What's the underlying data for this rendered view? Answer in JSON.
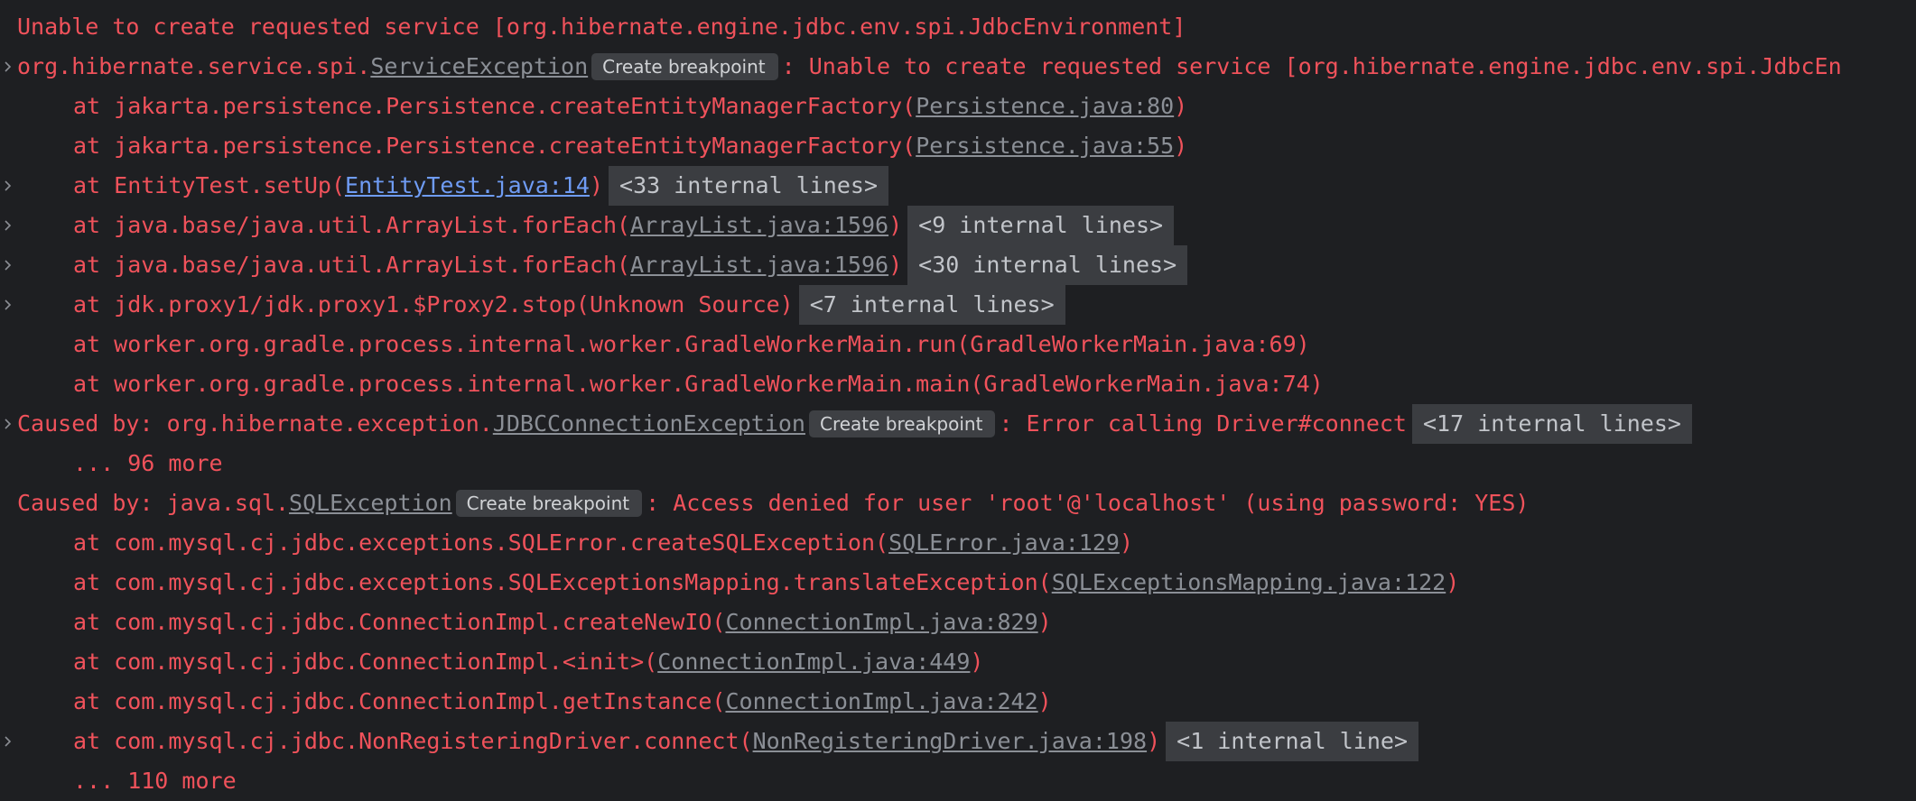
{
  "console": {
    "header": "Unable to create requested service [org.hibernate.engine.jdbc.env.spi.JdbcEnvironment]",
    "breakpoint_label": "Create breakpoint",
    "service_exception": {
      "prefix": "org.hibernate.service.spi.",
      "class_link": "ServiceException",
      "message": ": Unable to create requested service [org.hibernate.engine.jdbc.env.spi.JdbcEn"
    },
    "frames1": [
      {
        "text": "at jakarta.persistence.Persistence.createEntityManagerFactory(",
        "link": "Persistence.java:80",
        "suffix": ")"
      },
      {
        "text": "at jakarta.persistence.Persistence.createEntityManagerFactory(",
        "link": "Persistence.java:55",
        "suffix": ")"
      },
      {
        "text": "at EntityTest.setUp(",
        "link": "EntityTest.java:14",
        "suffix": ")",
        "internal": "<33 internal lines>"
      },
      {
        "text": "at java.base/java.util.ArrayList.forEach(",
        "link": "ArrayList.java:1596",
        "suffix": ")",
        "internal": "<9 internal lines>"
      },
      {
        "text": "at java.base/java.util.ArrayList.forEach(",
        "link": "ArrayList.java:1596",
        "suffix": ")",
        "internal": "<30 internal lines>"
      },
      {
        "text": "at jdk.proxy1/jdk.proxy1.$Proxy2.stop(Unknown Source)",
        "internal": "<7 internal lines>"
      },
      {
        "text": "at worker.org.gradle.process.internal.worker.GradleWorkerMain.run(GradleWorkerMain.java:69)"
      },
      {
        "text": "at worker.org.gradle.process.internal.worker.GradleWorkerMain.main(GradleWorkerMain.java:74)"
      }
    ],
    "caused1": {
      "prefix": "Caused by: org.hibernate.exception.",
      "class_link": "JDBCConnectionException",
      "message": ": Error calling Driver#connect",
      "internal": "<17 internal lines>",
      "more": "... 96 more"
    },
    "caused2": {
      "prefix": "Caused by: java.sql.",
      "class_link": "SQLException",
      "message": ": Access denied for user 'root'@'localhost' (using password: YES)"
    },
    "frames2": [
      {
        "text": "at com.mysql.cj.jdbc.exceptions.SQLError.createSQLException(",
        "link": "SQLError.java:129",
        "suffix": ")"
      },
      {
        "text": "at com.mysql.cj.jdbc.exceptions.SQLExceptionsMapping.translateException(",
        "link": "SQLExceptionsMapping.java:122",
        "suffix": ")"
      },
      {
        "text": "at com.mysql.cj.jdbc.ConnectionImpl.createNewIO(",
        "link": "ConnectionImpl.java:829",
        "suffix": ")"
      },
      {
        "text": "at com.mysql.cj.jdbc.ConnectionImpl.<init>(",
        "link": "ConnectionImpl.java:449",
        "suffix": ")"
      },
      {
        "text": "at com.mysql.cj.jdbc.ConnectionImpl.getInstance(",
        "link": "ConnectionImpl.java:242",
        "suffix": ")"
      },
      {
        "text": "at com.mysql.cj.jdbc.NonRegisteringDriver.connect(",
        "link": "NonRegisteringDriver.java:198",
        "suffix": ")",
        "internal": "<1 internal line>"
      }
    ],
    "more2": "... 110 more"
  },
  "colors": {
    "background": "#1e1f22",
    "error_text": "#f0525b",
    "link_gray": "#8b8f96",
    "link_blue": "#6f9cf5",
    "fold_bg": "#3b3d41"
  },
  "icons": {
    "fold": "chevron-right-icon"
  }
}
